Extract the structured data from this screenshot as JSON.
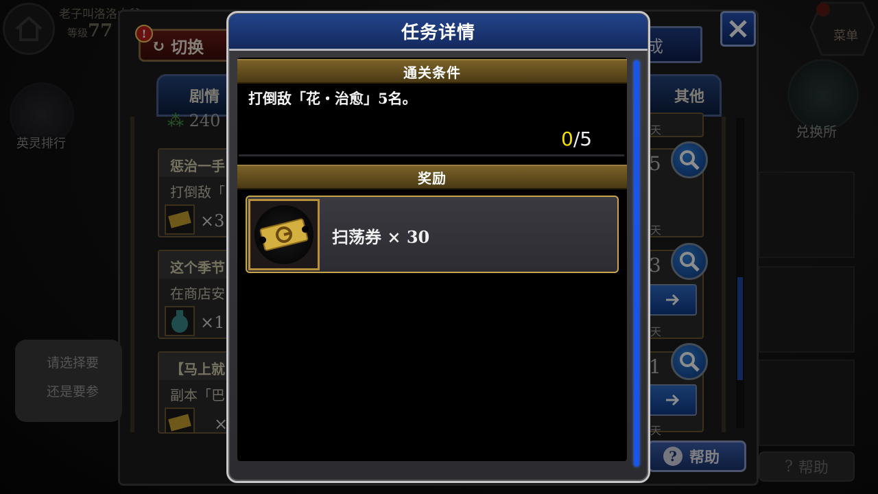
{
  "hud": {
    "player_name": "老子叫洛洛大爷",
    "level_label": "等级",
    "level_value": "77",
    "menu_label": "菜单",
    "ranking_label": "英灵排行",
    "exchange_label": "兑换所"
  },
  "background_panel": {
    "switch_label": "切换",
    "top_right_tab_partial": "成",
    "tabs": [
      "剧情",
      "其他"
    ],
    "currency_value": "240",
    "missions": [
      {
        "title": "惩治一手",
        "desc": "打倒敌「",
        "qty": "×3",
        "right_num": "5",
        "right_day": "天"
      },
      {
        "title": "这个季节",
        "desc": "在商店安",
        "qty": "×1",
        "right_num": "3",
        "right_day": "天"
      },
      {
        "title": "【马上就",
        "desc": "副本「巴",
        "qty": "×",
        "right_num": "1",
        "right_day": "天"
      }
    ],
    "top_day": "天",
    "help_label": "帮助"
  },
  "speech_bubble": {
    "line1": "请选择要",
    "line2": "还是要参"
  },
  "modal": {
    "title": "任务详情",
    "condition_header": "通关条件",
    "condition_text": "打倒敌「花・治愈」5名。",
    "progress_current": "0",
    "progress_total": "/5",
    "reward_header": "奖励",
    "reward_item": "扫荡券 × 30"
  },
  "colors": {
    "progress_current": "#f3e000",
    "section_header": "#6a5220",
    "modal_header": "#1c3a7a",
    "scrollbar": "#1a55e8",
    "reward_border": "#c9a54a"
  }
}
